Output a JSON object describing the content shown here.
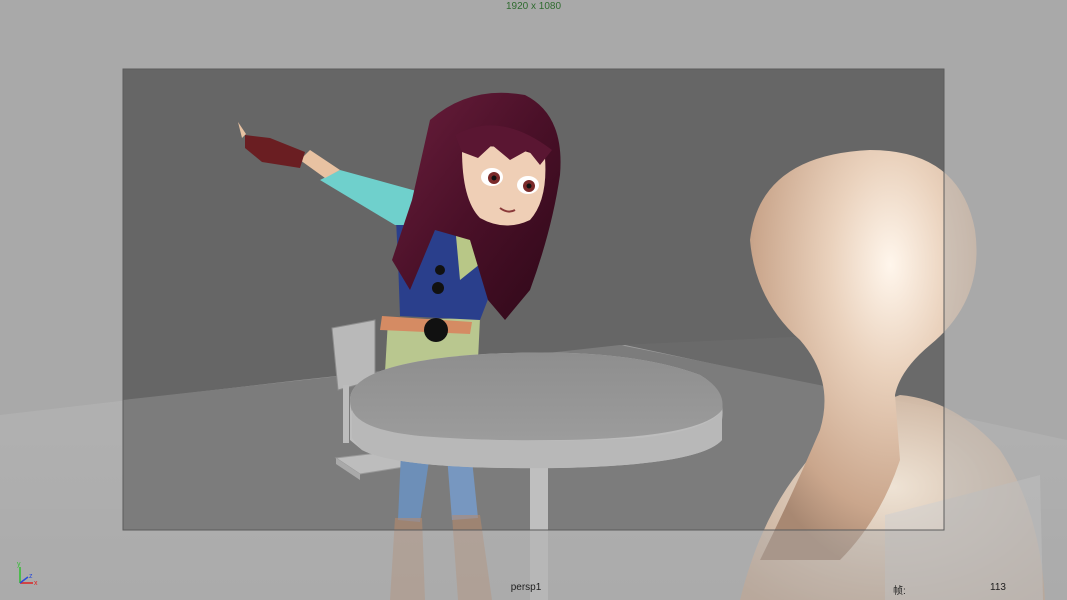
{
  "viewport": {
    "resolution_label": "1920 x 1080",
    "camera_name": "persp1",
    "frame_label": "帧:",
    "frame_value": "113",
    "axis_letters": {
      "x": "x",
      "y": "y",
      "z": "z"
    }
  },
  "colors": {
    "gate_mask": "#a9a9a9",
    "gate_background": "#6a6a6a",
    "floor": "#bdbdbd",
    "table": "#b4b4b4",
    "mannequin": "#e7cdb6",
    "resolution_label": "#2f6b2f",
    "hud_text": "#1e1e1e"
  }
}
